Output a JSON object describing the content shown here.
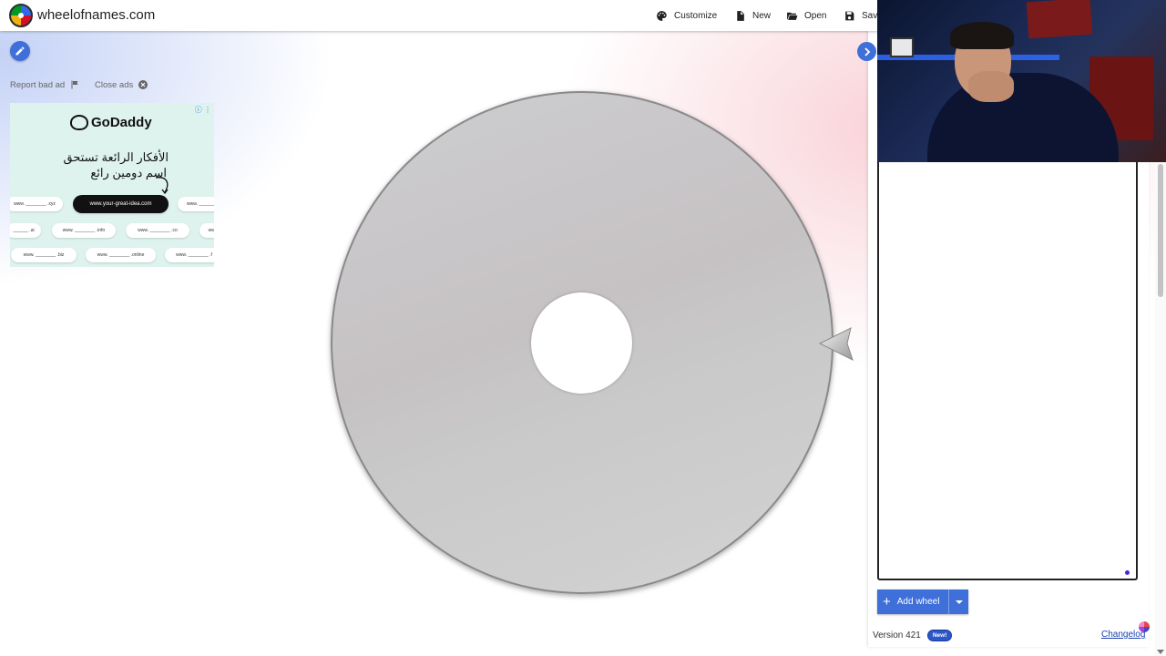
{
  "header": {
    "site_name": "wheelofnames.com",
    "buttons": {
      "customize": "Customize",
      "new": "New",
      "open": "Open",
      "save": "Save"
    }
  },
  "ad_controls": {
    "report": "Report bad ad",
    "close": "Close ads"
  },
  "ad": {
    "brand": "GoDaddy",
    "headline_line1": "الأفكار الرائعة تستحق",
    "headline_line2": "اسم دومين رائع",
    "cta": "www.your-great-idea.com",
    "pills": [
      "www. ________ .xyz",
      "www. ______",
      "______ .ai",
      "www. ________ .info",
      "www. ________ .co",
      "www",
      "www. ________ .biz",
      "www. ________ .online",
      "www. ________ .f"
    ]
  },
  "panel": {
    "add_wheel": "Add wheel",
    "version": "Version 421",
    "new_badge": "New!",
    "changelog": "Changelog"
  },
  "colors": {
    "accent": "#3f6fd8",
    "wheel": "#c9c9c9"
  }
}
